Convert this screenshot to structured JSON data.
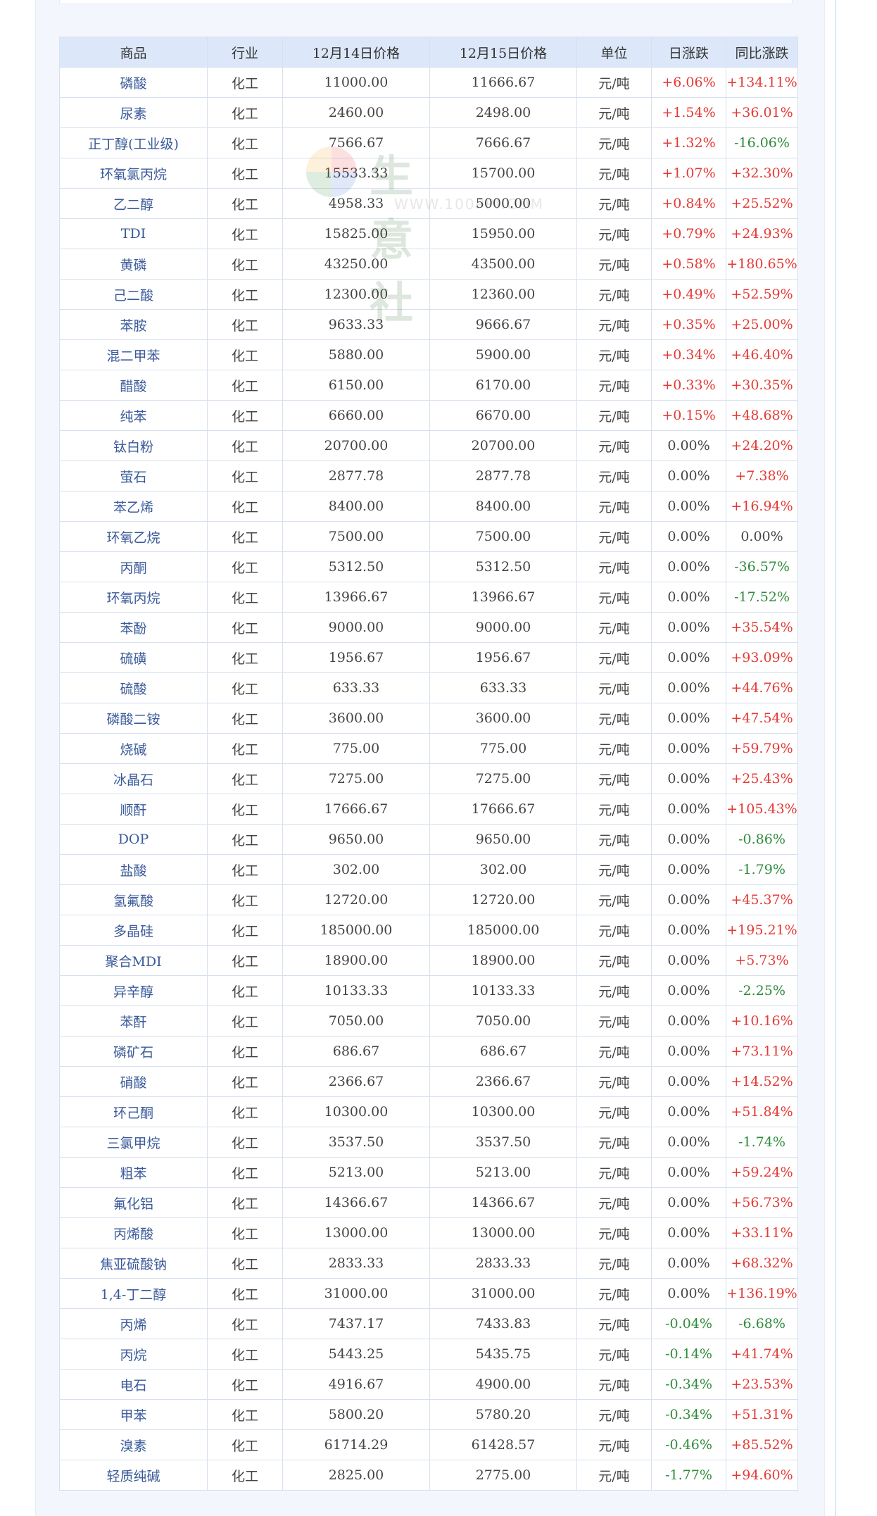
{
  "table": {
    "headers": [
      "商品",
      "行业",
      "12月14日价格",
      "12月15日价格",
      "单位",
      "日涨跌",
      "同比涨跌"
    ],
    "rows": [
      [
        "磷酸",
        "化工",
        "11000.00",
        "11666.67",
        "元/吨",
        "+6.06%",
        "+134.11%"
      ],
      [
        "尿素",
        "化工",
        "2460.00",
        "2498.00",
        "元/吨",
        "+1.54%",
        "+36.01%"
      ],
      [
        "正丁醇(工业级)",
        "化工",
        "7566.67",
        "7666.67",
        "元/吨",
        "+1.32%",
        "-16.06%"
      ],
      [
        "环氧氯丙烷",
        "化工",
        "15533.33",
        "15700.00",
        "元/吨",
        "+1.07%",
        "+32.30%"
      ],
      [
        "乙二醇",
        "化工",
        "4958.33",
        "5000.00",
        "元/吨",
        "+0.84%",
        "+25.52%"
      ],
      [
        "TDI",
        "化工",
        "15825.00",
        "15950.00",
        "元/吨",
        "+0.79%",
        "+24.93%"
      ],
      [
        "黄磷",
        "化工",
        "43250.00",
        "43500.00",
        "元/吨",
        "+0.58%",
        "+180.65%"
      ],
      [
        "己二酸",
        "化工",
        "12300.00",
        "12360.00",
        "元/吨",
        "+0.49%",
        "+52.59%"
      ],
      [
        "苯胺",
        "化工",
        "9633.33",
        "9666.67",
        "元/吨",
        "+0.35%",
        "+25.00%"
      ],
      [
        "混二甲苯",
        "化工",
        "5880.00",
        "5900.00",
        "元/吨",
        "+0.34%",
        "+46.40%"
      ],
      [
        "醋酸",
        "化工",
        "6150.00",
        "6170.00",
        "元/吨",
        "+0.33%",
        "+30.35%"
      ],
      [
        "纯苯",
        "化工",
        "6660.00",
        "6670.00",
        "元/吨",
        "+0.15%",
        "+48.68%"
      ],
      [
        "钛白粉",
        "化工",
        "20700.00",
        "20700.00",
        "元/吨",
        "0.00%",
        "+24.20%"
      ],
      [
        "萤石",
        "化工",
        "2877.78",
        "2877.78",
        "元/吨",
        "0.00%",
        "+7.38%"
      ],
      [
        "苯乙烯",
        "化工",
        "8400.00",
        "8400.00",
        "元/吨",
        "0.00%",
        "+16.94%"
      ],
      [
        "环氧乙烷",
        "化工",
        "7500.00",
        "7500.00",
        "元/吨",
        "0.00%",
        "0.00%"
      ],
      [
        "丙酮",
        "化工",
        "5312.50",
        "5312.50",
        "元/吨",
        "0.00%",
        "-36.57%"
      ],
      [
        "环氧丙烷",
        "化工",
        "13966.67",
        "13966.67",
        "元/吨",
        "0.00%",
        "-17.52%"
      ],
      [
        "苯酚",
        "化工",
        "9000.00",
        "9000.00",
        "元/吨",
        "0.00%",
        "+35.54%"
      ],
      [
        "硫磺",
        "化工",
        "1956.67",
        "1956.67",
        "元/吨",
        "0.00%",
        "+93.09%"
      ],
      [
        "硫酸",
        "化工",
        "633.33",
        "633.33",
        "元/吨",
        "0.00%",
        "+44.76%"
      ],
      [
        "磷酸二铵",
        "化工",
        "3600.00",
        "3600.00",
        "元/吨",
        "0.00%",
        "+47.54%"
      ],
      [
        "烧碱",
        "化工",
        "775.00",
        "775.00",
        "元/吨",
        "0.00%",
        "+59.79%"
      ],
      [
        "冰晶石",
        "化工",
        "7275.00",
        "7275.00",
        "元/吨",
        "0.00%",
        "+25.43%"
      ],
      [
        "顺酐",
        "化工",
        "17666.67",
        "17666.67",
        "元/吨",
        "0.00%",
        "+105.43%"
      ],
      [
        "DOP",
        "化工",
        "9650.00",
        "9650.00",
        "元/吨",
        "0.00%",
        "-0.86%"
      ],
      [
        "盐酸",
        "化工",
        "302.00",
        "302.00",
        "元/吨",
        "0.00%",
        "-1.79%"
      ],
      [
        "氢氟酸",
        "化工",
        "12720.00",
        "12720.00",
        "元/吨",
        "0.00%",
        "+45.37%"
      ],
      [
        "多晶硅",
        "化工",
        "185000.00",
        "185000.00",
        "元/吨",
        "0.00%",
        "+195.21%"
      ],
      [
        "聚合MDI",
        "化工",
        "18900.00",
        "18900.00",
        "元/吨",
        "0.00%",
        "+5.73%"
      ],
      [
        "异辛醇",
        "化工",
        "10133.33",
        "10133.33",
        "元/吨",
        "0.00%",
        "-2.25%"
      ],
      [
        "苯酐",
        "化工",
        "7050.00",
        "7050.00",
        "元/吨",
        "0.00%",
        "+10.16%"
      ],
      [
        "磷矿石",
        "化工",
        "686.67",
        "686.67",
        "元/吨",
        "0.00%",
        "+73.11%"
      ],
      [
        "硝酸",
        "化工",
        "2366.67",
        "2366.67",
        "元/吨",
        "0.00%",
        "+14.52%"
      ],
      [
        "环己酮",
        "化工",
        "10300.00",
        "10300.00",
        "元/吨",
        "0.00%",
        "+51.84%"
      ],
      [
        "三氯甲烷",
        "化工",
        "3537.50",
        "3537.50",
        "元/吨",
        "0.00%",
        "-1.74%"
      ],
      [
        "粗苯",
        "化工",
        "5213.00",
        "5213.00",
        "元/吨",
        "0.00%",
        "+59.24%"
      ],
      [
        "氟化铝",
        "化工",
        "14366.67",
        "14366.67",
        "元/吨",
        "0.00%",
        "+56.73%"
      ],
      [
        "丙烯酸",
        "化工",
        "13000.00",
        "13000.00",
        "元/吨",
        "0.00%",
        "+33.11%"
      ],
      [
        "焦亚硫酸钠",
        "化工",
        "2833.33",
        "2833.33",
        "元/吨",
        "0.00%",
        "+68.32%"
      ],
      [
        "1,4-丁二醇",
        "化工",
        "31000.00",
        "31000.00",
        "元/吨",
        "0.00%",
        "+136.19%"
      ],
      [
        "丙烯",
        "化工",
        "7437.17",
        "7433.83",
        "元/吨",
        "-0.04%",
        "-6.68%"
      ],
      [
        "丙烷",
        "化工",
        "5443.25",
        "5435.75",
        "元/吨",
        "-0.14%",
        "+41.74%"
      ],
      [
        "电石",
        "化工",
        "4916.67",
        "4900.00",
        "元/吨",
        "-0.34%",
        "+23.53%"
      ],
      [
        "甲苯",
        "化工",
        "5800.20",
        "5780.20",
        "元/吨",
        "-0.34%",
        "+51.31%"
      ],
      [
        "溴素",
        "化工",
        "61714.29",
        "61428.57",
        "元/吨",
        "-0.46%",
        "+85.52%"
      ],
      [
        "轻质纯碱",
        "化工",
        "2825.00",
        "2775.00",
        "元/吨",
        "-1.77%",
        "+94.60%"
      ]
    ]
  },
  "watermark": {
    "text": "生意社",
    "url": "WWW.100PPI.COM"
  },
  "colors": {
    "up": "#e53935",
    "down": "#2e8b3a",
    "flat": "#444444",
    "header_bg": "#dce8fa",
    "name": "#3a5a9a"
  }
}
